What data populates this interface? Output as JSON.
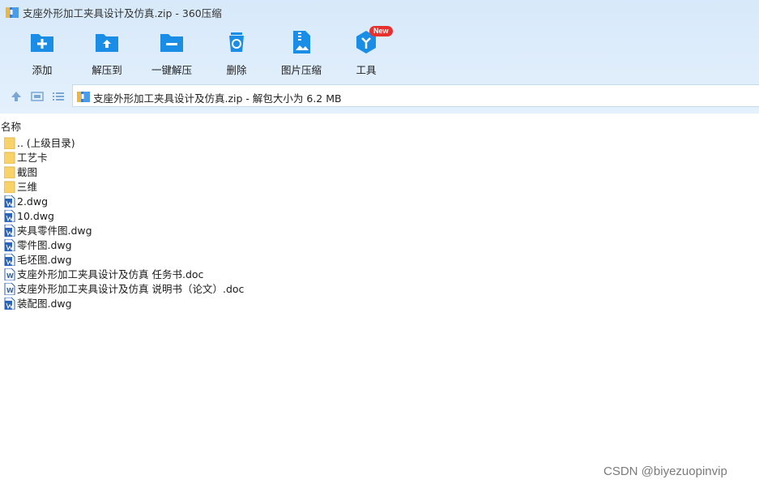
{
  "window": {
    "title": "支座外形加工夹具设计及仿真.zip - 360压缩"
  },
  "toolbar": {
    "items": [
      {
        "label": "添加",
        "icon": "add-icon"
      },
      {
        "label": "解压到",
        "icon": "extract-to-icon"
      },
      {
        "label": "一键解压",
        "icon": "one-click-extract-icon"
      },
      {
        "label": "删除",
        "icon": "delete-icon"
      },
      {
        "label": "图片压缩",
        "icon": "image-compress-icon"
      },
      {
        "label": "工具",
        "icon": "tools-icon",
        "badge": "New"
      }
    ]
  },
  "address": {
    "path": "支座外形加工夹具设计及仿真.zip - 解包大小为 6.2 MB"
  },
  "list": {
    "column_name": "名称",
    "files": [
      {
        "name": ".. (上级目录)",
        "type": "folder"
      },
      {
        "name": "工艺卡",
        "type": "folder"
      },
      {
        "name": "截图",
        "type": "folder"
      },
      {
        "name": "三维",
        "type": "folder"
      },
      {
        "name": "2.dwg",
        "type": "dwg"
      },
      {
        "name": "10.dwg",
        "type": "dwg"
      },
      {
        "name": "夹具零件图.dwg",
        "type": "dwg"
      },
      {
        "name": "零件图.dwg",
        "type": "dwg"
      },
      {
        "name": "毛坯图.dwg",
        "type": "dwg"
      },
      {
        "name": "支座外形加工夹具设计及仿真 任务书.doc",
        "type": "doc"
      },
      {
        "name": "支座外形加工夹具设计及仿真 说明书（论文）.doc",
        "type": "doc"
      },
      {
        "name": "装配图.dwg",
        "type": "dwg"
      }
    ]
  },
  "watermark": "CSDN @biyezuopinvip",
  "colors": {
    "accent": "#1a8ee6",
    "toolbar_bg": "#dcecfb",
    "badge": "#e8312f"
  }
}
